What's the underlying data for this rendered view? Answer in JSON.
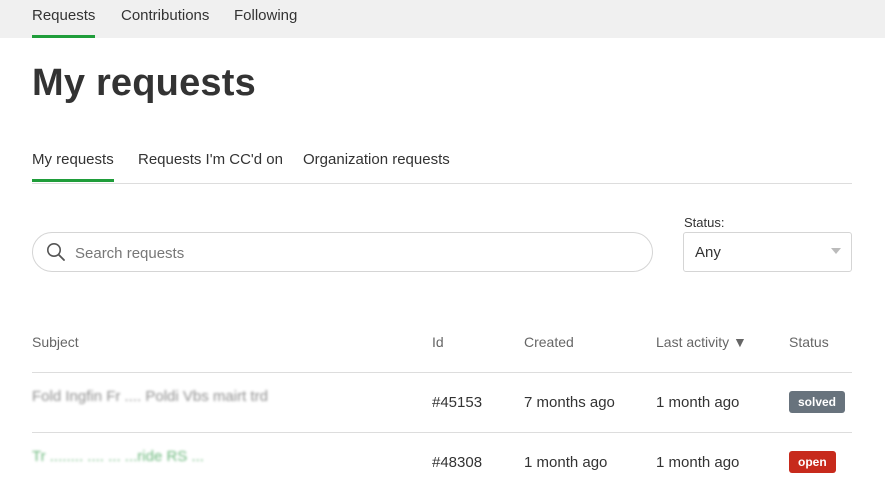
{
  "top_nav": {
    "items": [
      {
        "label": "Requests",
        "active": true
      },
      {
        "label": "Contributions",
        "active": false
      },
      {
        "label": "Following",
        "active": false
      }
    ]
  },
  "page_title": "My requests",
  "sub_tabs": [
    {
      "label": "My requests",
      "active": true
    },
    {
      "label": "Requests I'm CC'd on",
      "active": false
    },
    {
      "label": "Organization requests",
      "active": false
    }
  ],
  "search": {
    "placeholder": "Search requests",
    "value": "",
    "icon": "search-icon"
  },
  "status_filter": {
    "label": "Status:",
    "selected": "Any",
    "icon": "chevron-down-icon"
  },
  "table": {
    "columns": {
      "subject": "Subject",
      "id": "Id",
      "created": "Created",
      "last_activity": "Last activity ▼",
      "status": "Status"
    },
    "rows": [
      {
        "subject": "Fold   Ingfin   Fr  ....  Poldi   Vbs   mairt   trd",
        "id": "#45153",
        "created": "7 months ago",
        "last_activity": "1 month ago",
        "status": "solved",
        "status_color": "#68737d"
      },
      {
        "subject": "Tr   ........   ....   ...   ...ride   RS   ...",
        "id": "#48308",
        "created": "1 month ago",
        "last_activity": "1 month ago",
        "status": "open",
        "status_color": "#c72a1c"
      }
    ]
  },
  "colors": {
    "accent": "#1f9d3a",
    "top_nav_bg": "#f0f0f0",
    "divider": "#dddddd"
  }
}
